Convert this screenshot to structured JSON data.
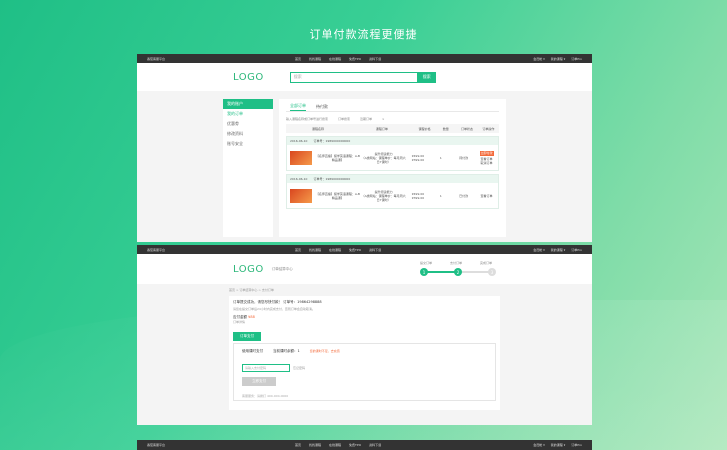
{
  "headline": "订单付款流程更便捷",
  "topbar": {
    "left": "番茄客服平台",
    "nav": [
      "首页",
      "找找课程",
      "在线课程",
      "免费TPO",
      "资料下载"
    ],
    "right": [
      "会员帐 ▾",
      "我的课程 ▾",
      "订单Pro"
    ]
  },
  "screen1": {
    "logo": "LOGO",
    "search_placeholder": "搜索",
    "search_btn": "搜索",
    "sidebar": {
      "title": "我的账户",
      "items": [
        "我的订单",
        "优惠劵",
        "修改资料",
        "账号安全"
      ]
    },
    "tabs": [
      "全部订单",
      "待付款"
    ],
    "filter": [
      "输入课程名称或订单号进行搜索",
      "订单搜索",
      "近期订单",
      "×"
    ],
    "columns": [
      "课程名称",
      "课程订单",
      "课程价格",
      "数量",
      "订单状态",
      "订单操作"
    ],
    "orders": [
      {
        "date": "2016-06-10",
        "order_no": "订单号：1989000000000",
        "name": "【名师直播】留学英语课程：A-B精品课】",
        "detail": "提升阅读能力",
        "detail2": "（A类网站：课程单价：每月周六日7课时）",
        "price": "¥499.00",
        "price2": "¥399.00",
        "qty": "1",
        "status": "待付款",
        "action": "立即付款",
        "action2": "查看订单",
        "action3": "取消订单"
      },
      {
        "date": "2016-06-10",
        "order_no": "订单号：1989000000000",
        "name": "【名师直播】留学英语课程：A-B精品课】",
        "detail": "提升阅读能力",
        "detail2": "（A类网站：课程单价：每月周六日7课时）",
        "price": "¥499.00",
        "price2": "¥399.00",
        "qty": "1",
        "status": "已付款",
        "action": "",
        "action2": "查看订单",
        "action3": ""
      }
    ]
  },
  "screen2": {
    "logo": "LOGO",
    "subtitle": "订单结算中心",
    "steps": [
      "提交订单",
      "支付订单",
      "完成订单"
    ],
    "crumb": "首页 > 订单结算中心 > 支付订单",
    "line1": "订单提交成功，请您尽快付款！  订单号：19864298888",
    "line2": "请您在提交订单后24小时内完成支付，否则订单会自动取消。",
    "amount_label": "应付金额",
    "amount": "¥88",
    "stock": "订单详情",
    "pay_btn": "订单支付",
    "box_title": "使用课时支付",
    "box_sub": "当前课时余额：1",
    "box_warn": "您的课时不足，去充值",
    "pwd_placeholder": "请输入支付密码",
    "pwd_hint": "忘记密码",
    "submit": "立即支付",
    "footnote": "客服服务：请拨打  400-000-0000"
  }
}
